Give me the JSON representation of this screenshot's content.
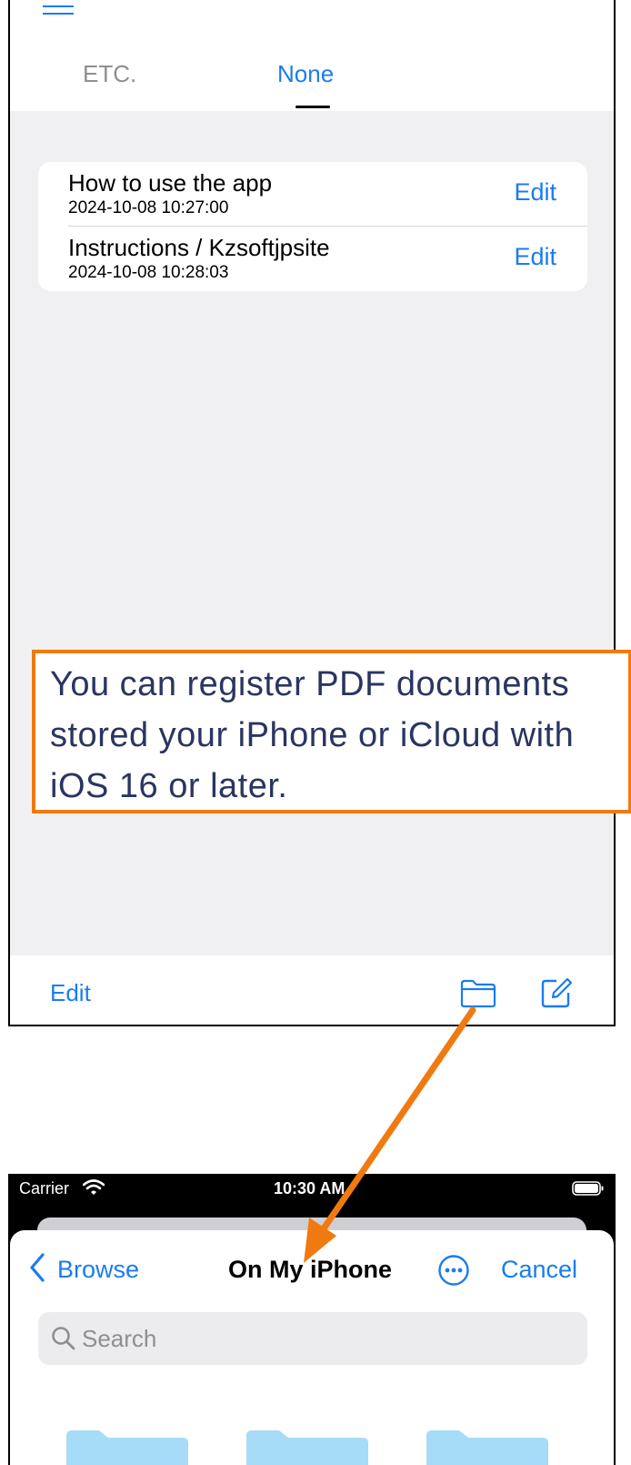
{
  "tabs": [
    {
      "label": "ETC.",
      "active": false
    },
    {
      "label": "None",
      "active": true
    }
  ],
  "documents": [
    {
      "title": "How to use the app",
      "date": "2024-10-08 10:27:00",
      "action": "Edit"
    },
    {
      "title": "Instructions / Kzsoftjpsite",
      "date": "2024-10-08 10:28:03",
      "action": "Edit"
    }
  ],
  "callout": {
    "text": "You can register PDF documents stored your iPhone or iCloud with iOS 16 or later.",
    "border_color": "#f07a10"
  },
  "toolbar": {
    "edit_label": "Edit",
    "icons": [
      "folder-icon",
      "compose-icon"
    ]
  },
  "picker": {
    "status": {
      "carrier": "Carrier",
      "time": "10:30 AM"
    },
    "back_label": "Browse",
    "title": "On My iPhone",
    "cancel_label": "Cancel",
    "search_placeholder": "Search"
  },
  "colors": {
    "accent": "#1a7cf0",
    "background": "#f0f0f3",
    "arrow": "#f07a10"
  }
}
